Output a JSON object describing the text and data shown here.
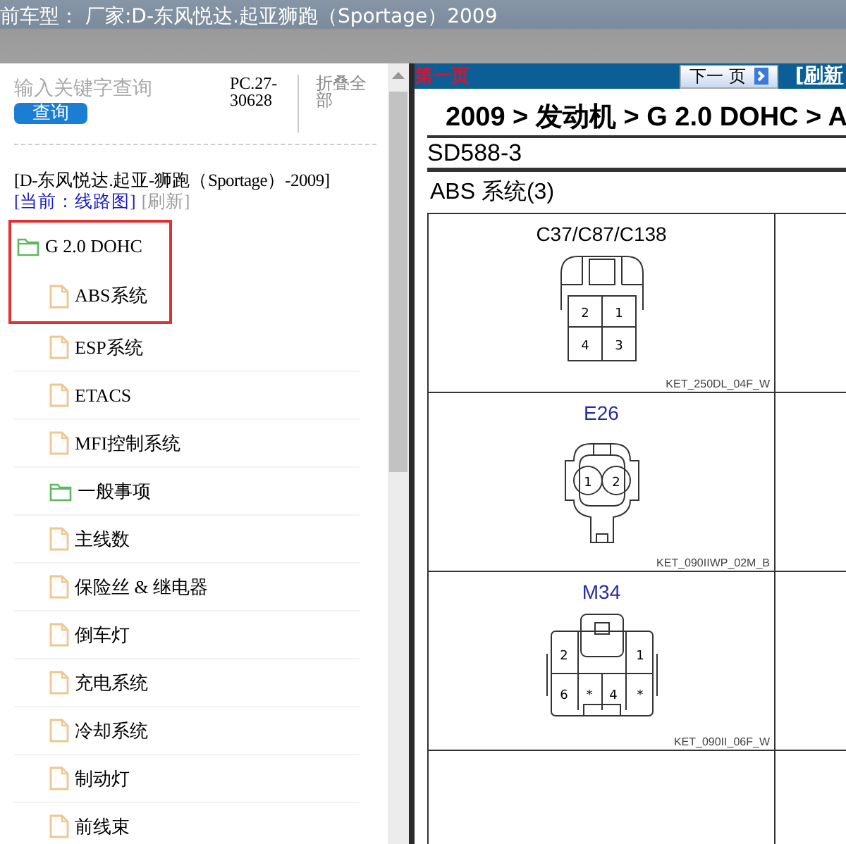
{
  "title_bar": {
    "text": "前车型： 厂家:D-东风悦达.起亚狮跑（Sportage）2009"
  },
  "sidebar": {
    "search": {
      "placeholder": "输入关键字查询",
      "button": "查询"
    },
    "code": "PC.27-30628",
    "collapse_all": "折叠全部",
    "model": "[D-东风悦达.起亚-狮跑（Sportage）-2009]",
    "current": "[当前：线路图]",
    "refresh": "[刷新]",
    "tree": [
      {
        "label": "G 2.0 DOHC",
        "kind": "folder",
        "highlighted": true,
        "children": [
          {
            "label": "ABS系统",
            "kind": "file",
            "highlighted": true
          },
          {
            "label": "ESP系统",
            "kind": "file",
            "highlighted": false
          },
          {
            "label": "ETACS",
            "kind": "file",
            "highlighted": false
          },
          {
            "label": "MFI控制系统",
            "kind": "file",
            "highlighted": false
          },
          {
            "label": "一般事项",
            "kind": "folder",
            "highlighted": false
          },
          {
            "label": "主线数",
            "kind": "file",
            "highlighted": false
          },
          {
            "label": "保险丝 & 继电器",
            "kind": "file",
            "highlighted": false
          },
          {
            "label": "倒车灯",
            "kind": "file",
            "highlighted": false
          },
          {
            "label": "充电系统",
            "kind": "file",
            "highlighted": false
          },
          {
            "label": "冷却系统",
            "kind": "file",
            "highlighted": false
          },
          {
            "label": "制动灯",
            "kind": "file",
            "highlighted": false
          },
          {
            "label": "前线束",
            "kind": "file",
            "highlighted": false
          }
        ]
      }
    ]
  },
  "document": {
    "page_status": "第一页",
    "next_button": "下一 页",
    "refresh_link": "[刷新",
    "breadcrumb": "2009 > 发动机 > G 2.0 DOHC > A",
    "code": "SD588-3",
    "section": "ABS 系统(3)",
    "connectors": [
      {
        "name": "C37/C87/C138",
        "color": "#000000",
        "kind": "four-pin",
        "pins": [
          "2",
          "1",
          "4",
          "3"
        ],
        "part": "KET_250DL_04F_W"
      },
      {
        "name": "E26",
        "color": "#2b2b9a",
        "kind": "two-pin",
        "pins": [
          "1",
          "2"
        ],
        "part": "KET_090IIWP_02M_B"
      },
      {
        "name": "M34",
        "color": "#2b2b9a",
        "kind": "six-pin",
        "pins": [
          "2",
          "1",
          "6",
          "*",
          "4",
          "*"
        ],
        "part": "KET_090II_06F_W"
      }
    ]
  }
}
